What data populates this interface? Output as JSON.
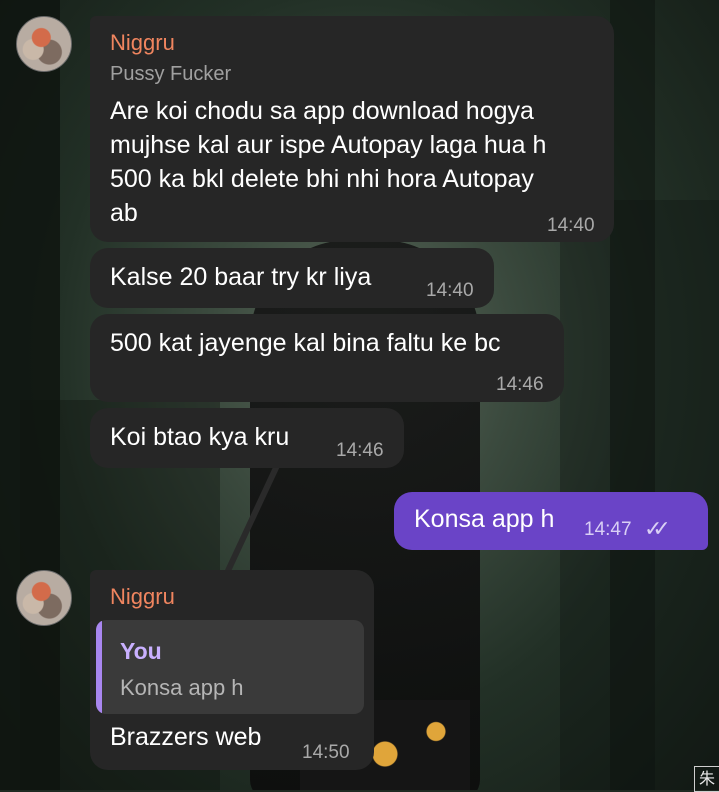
{
  "chat": {
    "group1": {
      "sender_name": "Niggru",
      "sender_subtitle": "Pussy Fucker",
      "messages": [
        {
          "text": "Are koi chodu sa app download hogya\nmujhse kal aur ispe Autopay laga hua h\n500 ka bkl delete bhi nhi hora Autopay\nab",
          "time": "14:40"
        },
        {
          "text": "Kalse 20 baar try kr liya",
          "time": "14:40"
        },
        {
          "text": "500 kat jayenge kal bina faltu ke bc",
          "time": "14:46"
        },
        {
          "text": "Koi btao kya kru",
          "time": "14:46"
        }
      ]
    },
    "outgoing": {
      "text": "Konsa app h",
      "time": "14:47",
      "status_icon": "double-check-icon"
    },
    "group2": {
      "sender_name": "Niggru",
      "reply_to": {
        "name": "You",
        "text": "Konsa app h"
      },
      "message": {
        "text": "Brazzers web",
        "time": "14:50"
      }
    }
  },
  "watermark": {
    "char": "朱"
  },
  "colors": {
    "incoming_bubble": "#262626",
    "outgoing_bubble": "#6a44c7",
    "sender_name": "#f0855f",
    "reply_bar": "#a986f0"
  }
}
